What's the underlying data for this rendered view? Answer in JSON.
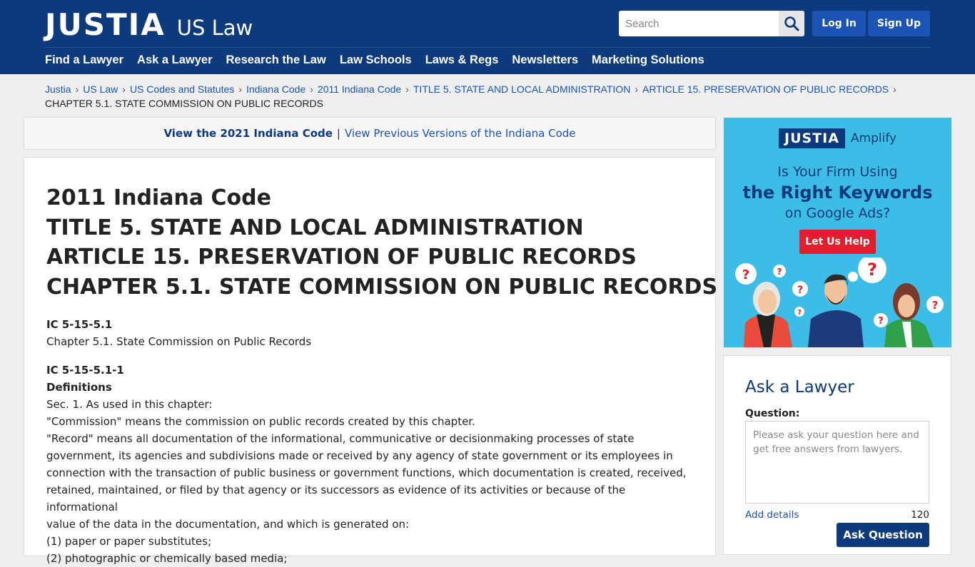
{
  "header": {
    "logo_main": "JUSTIA",
    "logo_sub": "US Law",
    "search_placeholder": "Search",
    "login": "Log In",
    "signup": "Sign Up"
  },
  "nav": [
    "Find a Lawyer",
    "Ask a Lawyer",
    "Research the Law",
    "Law Schools",
    "Laws & Regs",
    "Newsletters",
    "Marketing Solutions"
  ],
  "breadcrumb": {
    "links": [
      "Justia",
      "US Law",
      "US Codes and Statutes",
      "Indiana Code",
      "2011 Indiana Code",
      "TITLE 5. STATE AND LOCAL ADMINISTRATION",
      "ARTICLE 15. PRESERVATION OF PUBLIC RECORDS"
    ],
    "current": "CHAPTER 5.1. STATE COMMISSION ON PUBLIC RECORDS"
  },
  "version_bar": {
    "current": "View the 2021 Indiana Code",
    "separator": "|",
    "previous": "View Previous Versions of the Indiana Code"
  },
  "main": {
    "title_lines": [
      "2011 Indiana Code",
      "TITLE 5. STATE AND LOCAL ADMINISTRATION",
      "ARTICLE 15. PRESERVATION OF PUBLIC RECORDS",
      "CHAPTER 5.1. STATE COMMISSION ON PUBLIC RECORDS"
    ],
    "sections": [
      {
        "cite": "IC 5-15-5.1",
        "lines": [
          "Chapter 5.1. State Commission on Public Records"
        ]
      },
      {
        "cite": "IC 5-15-5.1-1",
        "heading": "Definitions",
        "lines": [
          "Sec. 1. As used in this chapter:",
          "\"Commission\" means the commission on public records created by this chapter.",
          "\"Record\" means all documentation of the informational, communicative or decisionmaking processes of state",
          "government, its agencies and subdivisions made or received by any agency of state government or its employees in",
          "connection with the transaction of public business or government functions, which documentation is created, received,",
          "retained, maintained, or filed by that agency or its successors as evidence of its activities or because of the informational",
          "value of the data in the documentation, and which is generated on:",
          "(1) paper or paper substitutes;",
          "(2) photographic or chemically based media;"
        ]
      }
    ]
  },
  "ad": {
    "logo": "JUSTIA",
    "logo_sub": "Amplify",
    "line1": "Is Your Firm Using",
    "line2": "the Right Keywords",
    "line3": "on Google Ads?",
    "button": "Let Us Help",
    "colors": {
      "bg": "#3cbde8",
      "button": "#e31d2b"
    }
  },
  "ask": {
    "title": "Ask a Lawyer",
    "question_label": "Question:",
    "placeholder": "Please ask your question here and get free answers from lawyers.",
    "add_details": "Add details",
    "count": "120",
    "button": "Ask Question"
  },
  "colors": {
    "header_bg": "#0c3a7d",
    "button_blue": "#1b54b5",
    "link": "#1b54b5"
  }
}
